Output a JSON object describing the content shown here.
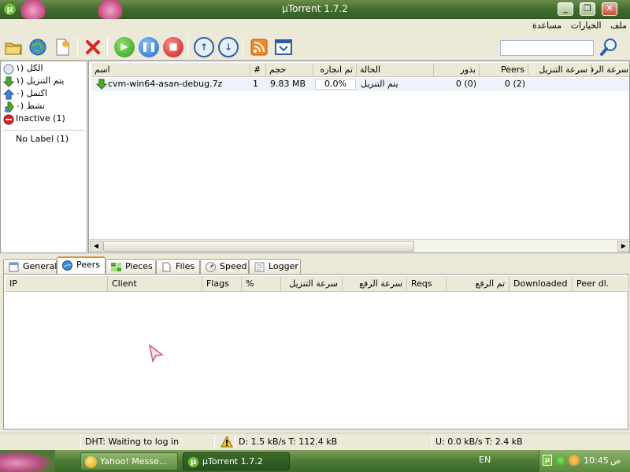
{
  "window": {
    "title": "µTorrent 1.7.2",
    "logo_letter": "µ",
    "minimize_glyph": "_",
    "maximize_glyph": "❐",
    "close_glyph": "✕"
  },
  "menu": [
    "ملف",
    "الخيارات",
    "مساعدة"
  ],
  "toolbar": {
    "icons": [
      "open-folder-icon",
      "globe-add-url-icon",
      "create-torrent-icon",
      "remove-icon",
      "start-icon",
      "pause-icon",
      "stop-icon",
      "move-up-icon",
      "move-down-icon",
      "rss-icon",
      "preferences-icon",
      "search-icon"
    ],
    "search_placeholder": ""
  },
  "categories": [
    {
      "label": "الكل (١",
      "icon": "all-icon"
    },
    {
      "label": "يتم التنزيل (١",
      "icon": "downloading-icon"
    },
    {
      "label": "اكتمل (٠",
      "icon": "completed-icon"
    },
    {
      "label": "نشط (٠",
      "icon": "active-icon"
    },
    {
      "label": "Inactive (1)",
      "icon": "inactive-icon"
    },
    {
      "label": "No Label (1)",
      "icon": ""
    }
  ],
  "torrent_columns": [
    "اسم",
    "#",
    "حجم",
    "تم انجازه",
    "الحالة",
    "بذور",
    "Peers",
    "سرعة التنزيل",
    "سرعة الرفع"
  ],
  "torrents": [
    {
      "name": "cvm-win64-asan-debug.7z",
      "num": "1",
      "size": "9.83 MB",
      "done": "0.0%",
      "status": "يتم التنزيل",
      "seeds": "0 (0)",
      "peers": "0 (2)",
      "down_speed": "",
      "up_speed": ""
    }
  ],
  "tabs": [
    {
      "label": "General",
      "icon": "general-icon"
    },
    {
      "label": "Peers",
      "icon": "peers-icon",
      "active": true
    },
    {
      "label": "Pieces",
      "icon": "pieces-icon"
    },
    {
      "label": "Files",
      "icon": "files-icon"
    },
    {
      "label": "Speed",
      "icon": "speed-icon"
    },
    {
      "label": "Logger",
      "icon": "logger-icon"
    }
  ],
  "peer_columns": [
    "IP",
    "Client",
    "Flags",
    "%",
    "سرعة التنزيل",
    "سرعة الرفع",
    "Reqs",
    "تم الرفع",
    "Downloaded",
    "Peer dl."
  ],
  "status": {
    "dht": "DHT: Waiting to log in",
    "download": "D: 1.5 kB/s T: 112.4 kB",
    "upload": "U: 0.0 kB/s T: 2.4 kB"
  },
  "taskbar": {
    "items": [
      {
        "label": "Yahoo! Messe...",
        "icon": "yahoo-messenger-icon"
      },
      {
        "label": "µTorrent 1.7.2",
        "icon": "utorrent-icon",
        "active": true
      }
    ],
    "language": "EN",
    "time": "10:45",
    "ampm": "ص"
  },
  "colors": {
    "accent_green": "#6fbe3a",
    "tab_highlight": "#e68b2c",
    "taskbar": "#4c7a35"
  }
}
